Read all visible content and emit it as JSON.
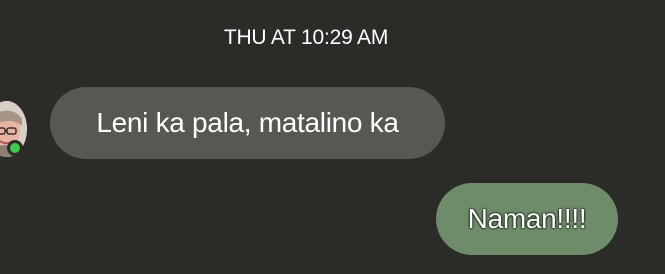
{
  "conversation": {
    "timestamp": "THU AT 10:29 AM",
    "messages": [
      {
        "direction": "incoming",
        "text": "Leni ka pala, matalino ka",
        "bubble_color": "#595752"
      },
      {
        "direction": "outgoing",
        "text": "Naman!!!!",
        "bubble_color": "#6f8c6a"
      }
    ],
    "sender": {
      "avatar_icon": "profile-photo",
      "presence": "online",
      "presence_color": "#43c84f"
    }
  },
  "colors": {
    "background": "#2b2b28",
    "text": "#ffffff"
  }
}
